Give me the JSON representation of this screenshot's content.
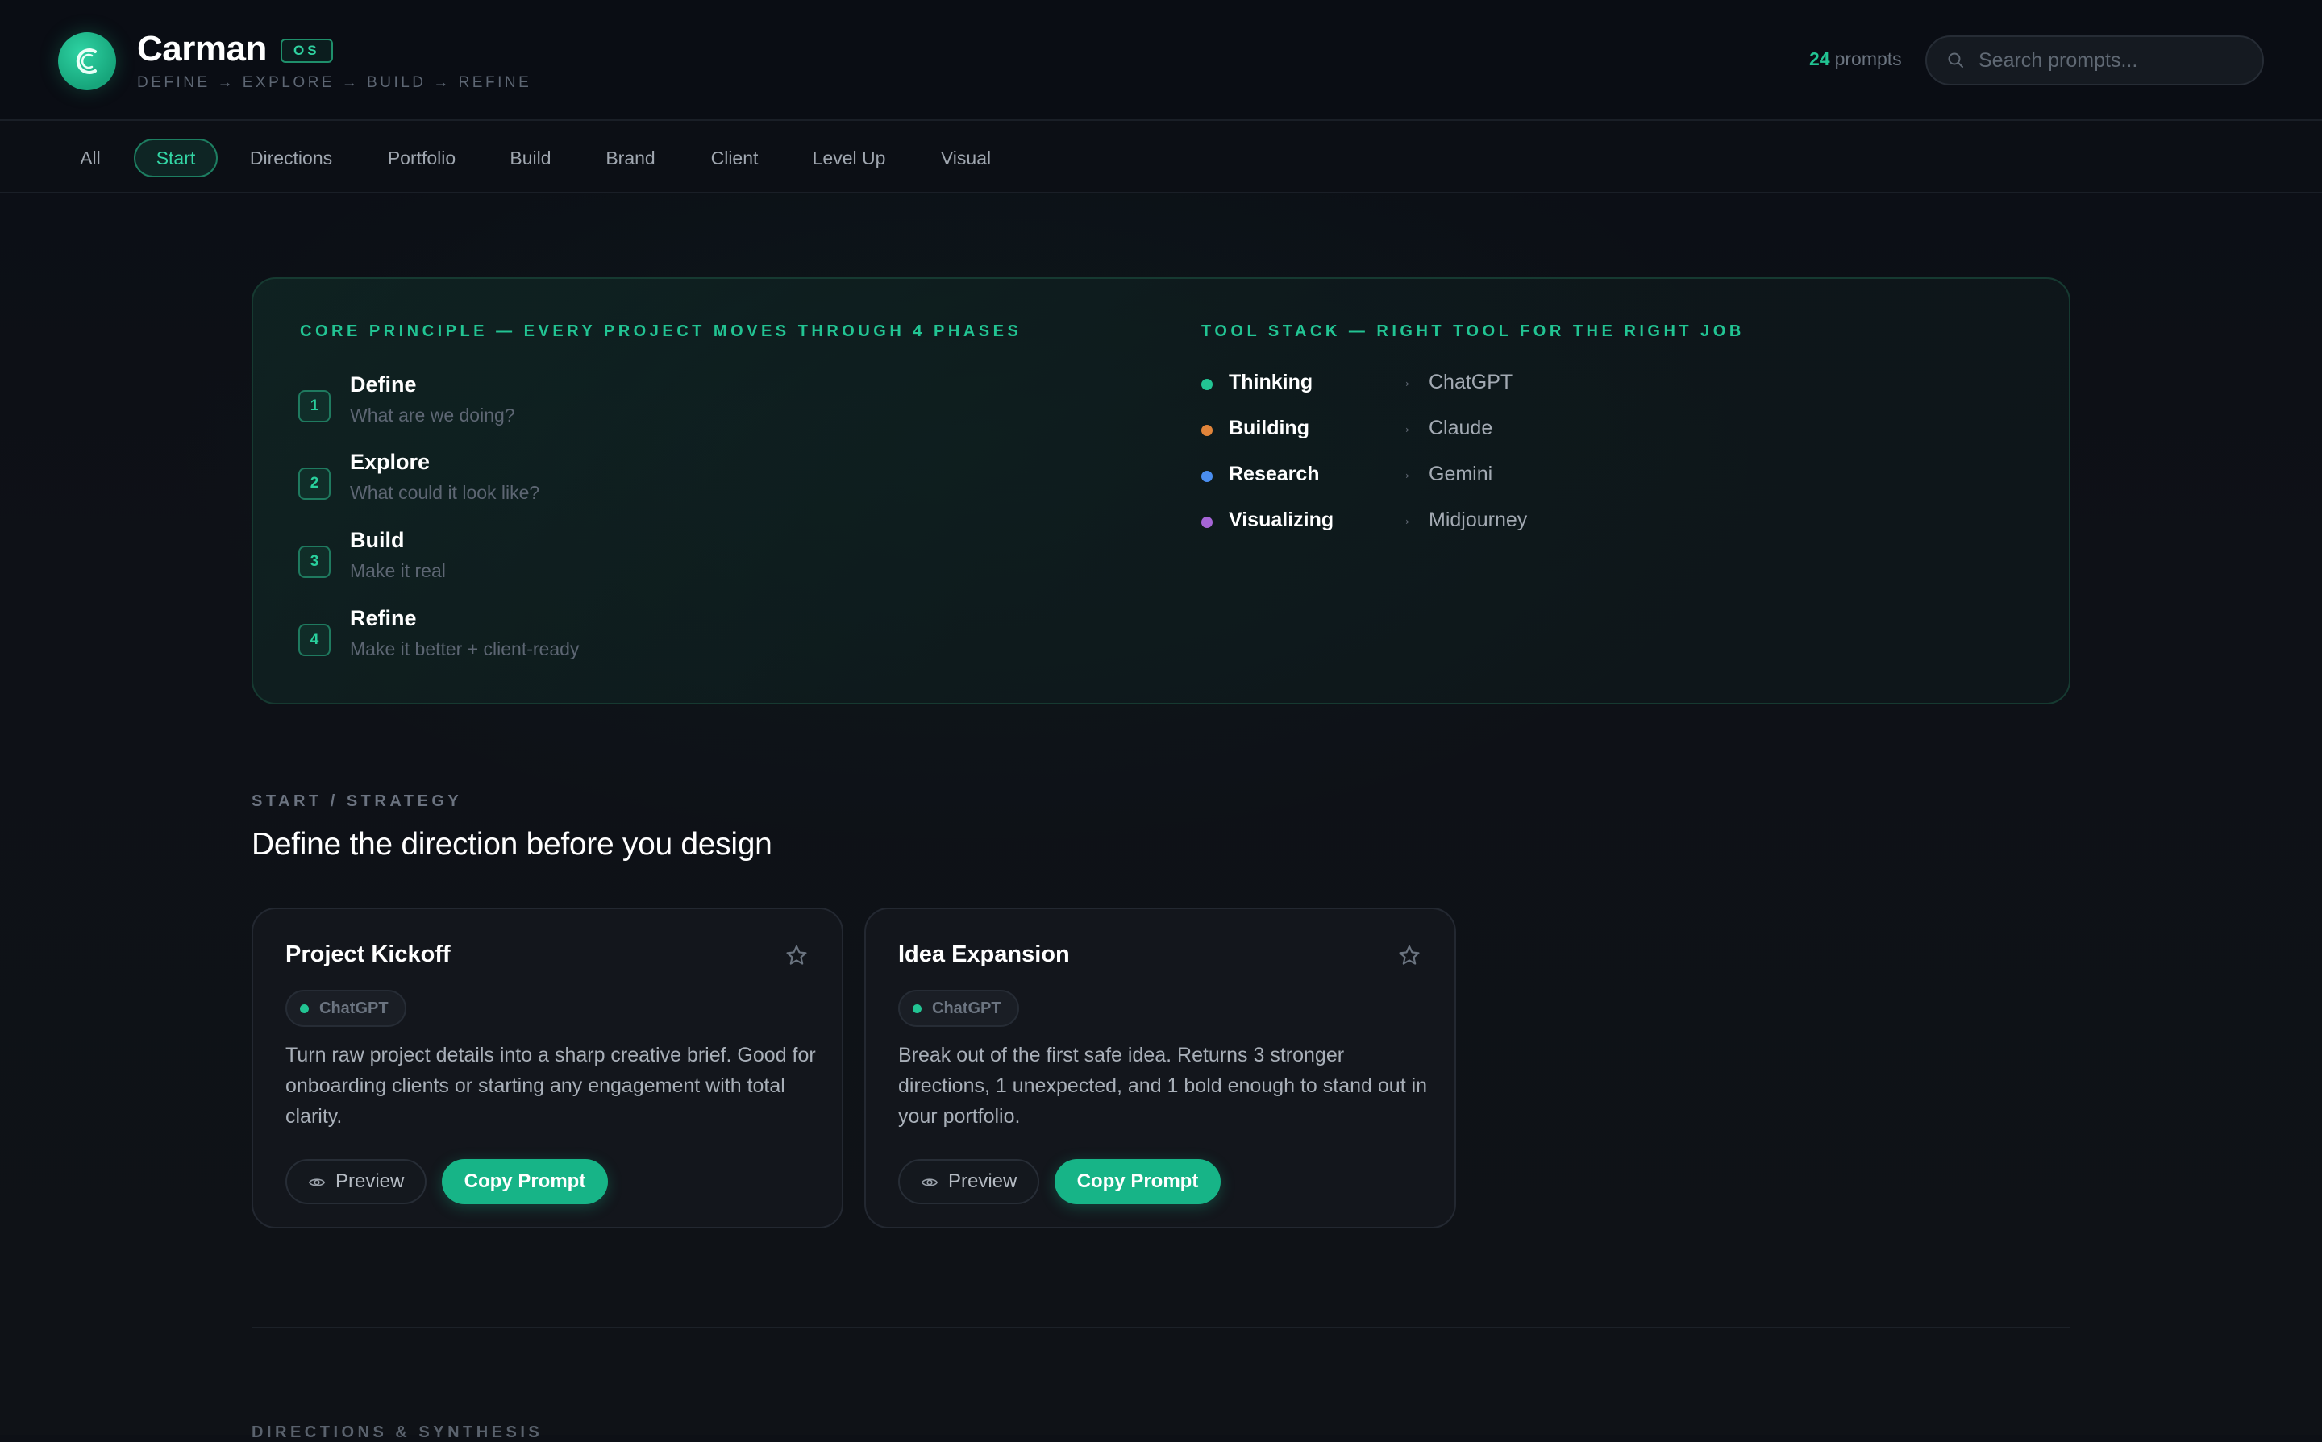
{
  "app": {
    "name": "Carman",
    "badge": "OS",
    "phase_line": "DEFINE → EXPLORE → BUILD → REFINE",
    "prompt_count": "24",
    "prompt_count_label": "prompts"
  },
  "search": {
    "placeholder": "Search prompts..."
  },
  "tabs": [
    {
      "label": "All"
    },
    {
      "label": "Start"
    },
    {
      "label": "Directions"
    },
    {
      "label": "Portfolio"
    },
    {
      "label": "Build"
    },
    {
      "label": "Brand"
    },
    {
      "label": "Client"
    },
    {
      "label": "Level Up"
    },
    {
      "label": "Visual"
    }
  ],
  "active_tab": "Start",
  "core": {
    "heading": "CORE PRINCIPLE — EVERY PROJECT MOVES THROUGH 4 PHASES",
    "phases": [
      {
        "num": "1",
        "name": "Define",
        "desc": "What are we doing?"
      },
      {
        "num": "2",
        "name": "Explore",
        "desc": "What could it look like?"
      },
      {
        "num": "3",
        "name": "Build",
        "desc": "Make it real"
      },
      {
        "num": "4",
        "name": "Refine",
        "desc": "Make it better + client-ready"
      }
    ]
  },
  "tools": {
    "heading": "TOOL STACK — RIGHT TOOL FOR THE RIGHT JOB",
    "items": [
      {
        "task": "Thinking",
        "arrow": "→",
        "app": "ChatGPT",
        "color": "#22c493"
      },
      {
        "task": "Building",
        "arrow": "→",
        "app": "Claude",
        "color": "#e0843a"
      },
      {
        "task": "Research",
        "arrow": "→",
        "app": "Gemini",
        "color": "#4a8ef0"
      },
      {
        "task": "Visualizing",
        "arrow": "→",
        "app": "Midjourney",
        "color": "#a565d6"
      }
    ]
  },
  "section": {
    "label": "START / STRATEGY",
    "title": "Define the direction before you design"
  },
  "cards": [
    {
      "title": "Project Kickoff",
      "tag": "ChatGPT",
      "desc": "Turn raw project details into a sharp creative brief. Good for onboarding clients or starting any engagement with total clarity.",
      "preview_label": "Preview",
      "copy_label": "Copy Prompt"
    },
    {
      "title": "Idea Expansion",
      "tag": "ChatGPT",
      "desc": "Break out of the first safe idea. Returns 3 stronger directions, 1 unexpected, and 1 bold enough to stand out in your portfolio.",
      "preview_label": "Preview",
      "copy_label": "Copy Prompt"
    }
  ],
  "next_section_label": "DIRECTIONS & SYNTHESIS",
  "colors": {
    "accent": "#22c493",
    "button": "#17b487"
  }
}
